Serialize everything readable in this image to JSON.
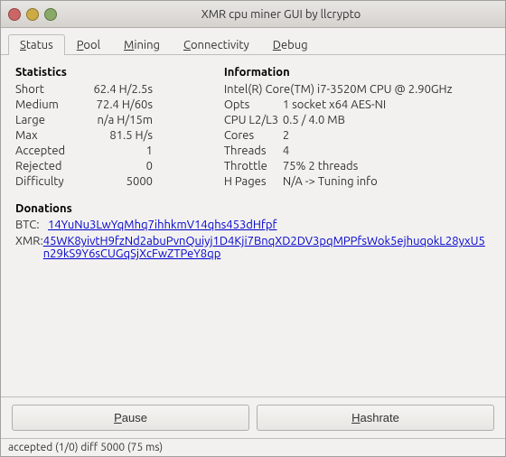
{
  "window": {
    "title": "XMR cpu miner GUI by llcrypto"
  },
  "tabs": [
    {
      "label": "Status",
      "underline_char": "S",
      "active": true
    },
    {
      "label": "Pool",
      "underline_char": "P",
      "active": false
    },
    {
      "label": "Mining",
      "underline_char": "M",
      "active": false
    },
    {
      "label": "Connectivity",
      "underline_char": "C",
      "active": false
    },
    {
      "label": "Debug",
      "underline_char": "D",
      "active": false
    }
  ],
  "statistics": {
    "title": "Statistics",
    "rows": [
      {
        "label": "Short",
        "value": "62.4 H/2.5s"
      },
      {
        "label": "Medium",
        "value": "72.4 H/60s"
      },
      {
        "label": "Large",
        "value": "n/a H/15m"
      },
      {
        "label": "Max",
        "value": "81.5 H/s"
      },
      {
        "label": "Accepted",
        "value": "1"
      },
      {
        "label": "Rejected",
        "value": "0"
      },
      {
        "label": "Difficulty",
        "value": "5000"
      }
    ]
  },
  "information": {
    "title": "Information",
    "rows": [
      {
        "label": "Intel(R) Core(TM) i7-3520M CPU @ 2.90GHz",
        "is_header": true
      },
      {
        "label": "Opts",
        "value": "1 socket x64 AES-NI"
      },
      {
        "label": "CPU L2/L3",
        "value": "0.5 / 4.0 MB"
      },
      {
        "label": "Cores",
        "value": "2"
      },
      {
        "label": "Threads",
        "value": "4"
      },
      {
        "label": "Throttle",
        "value": "75% 2 threads"
      },
      {
        "label": "H Pages",
        "value": "N/A -> Tuning info"
      }
    ]
  },
  "donations": {
    "title": "Donations",
    "btc_label": "BTC:",
    "btc_address": "14YuNu3LwYqMhq7ihhkmV14qhs453dHfpf",
    "xmr_label": "XMR:",
    "xmr_address": "45WK8yivtH9fzNd2abuPvnQuiyj1D4Kji7BnqXD2DV3pqMPPfsWok5ejhuqokL28yxU5n29kS9Y6sCUGqSjXcFwZTPeY8qp"
  },
  "buttons": {
    "pause": "Pause",
    "hashrate": "Hashrate"
  },
  "statusbar": {
    "text": "accepted (1/0) diff 5000 (75 ms)"
  }
}
